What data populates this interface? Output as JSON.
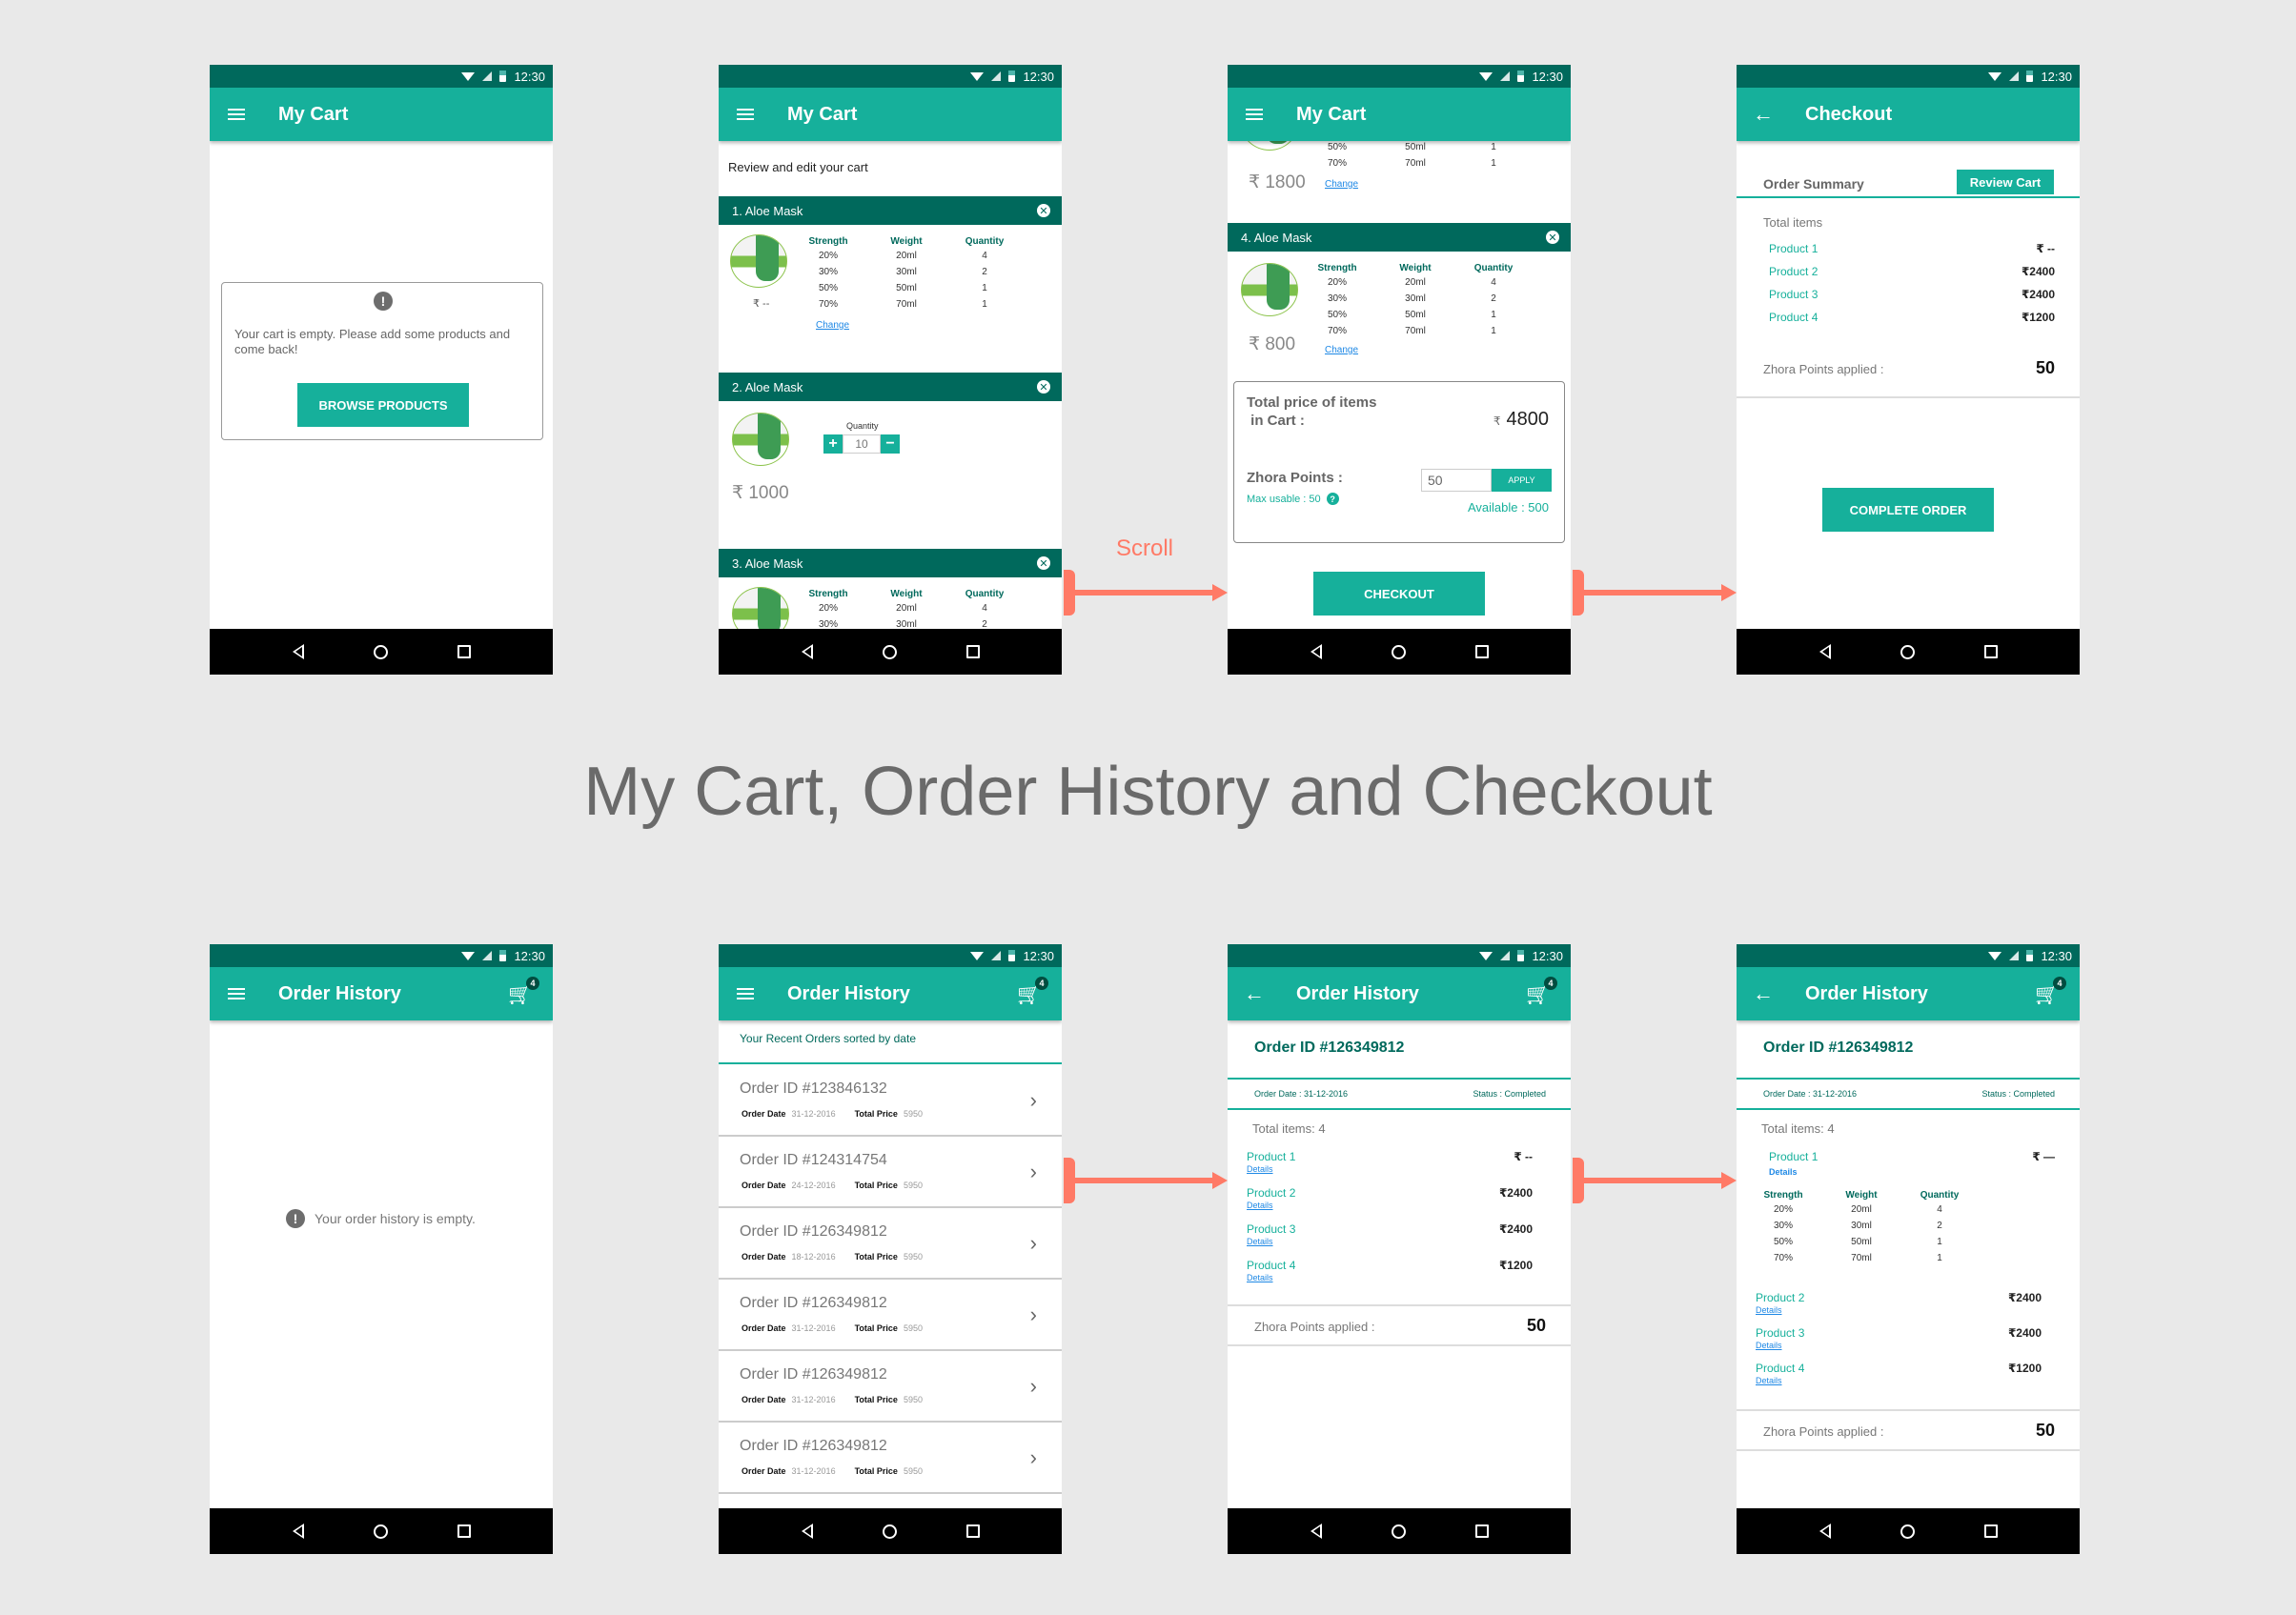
{
  "page_title": "My Cart, Order History and Checkout",
  "status_bar": {
    "time": "12:30"
  },
  "colors": {
    "primary": "#16b09b",
    "primary_dark": "#00695c",
    "accent_arrow": "#ff7a66",
    "link": "#1e88e5",
    "background": "#e9e9e9"
  },
  "flow_arrows": {
    "scroll_label": "Scroll"
  },
  "screens": {
    "cart_empty": {
      "title": "My Cart",
      "nav_icon": "hamburger-menu-icon",
      "message": "Your cart is empty. Please add some products and come back!",
      "browse_button": "BROWSE PRODUCTS"
    },
    "cart_review": {
      "title": "My Cart",
      "subtitle": "Review and edit your cart",
      "columns": [
        "Strength",
        "Weight",
        "Quantity"
      ],
      "items": [
        {
          "name": "1. Aloe Mask",
          "price": "₹ --",
          "change": "Change",
          "variants": [
            [
              "20%",
              "20ml",
              "4"
            ],
            [
              "30%",
              "30ml",
              "2"
            ],
            [
              "50%",
              "50ml",
              "1"
            ],
            [
              "70%",
              "70ml",
              "1"
            ]
          ]
        },
        {
          "name": "2. Aloe Mask",
          "price": "₹ 1000",
          "quantity_label": "Quantity",
          "quantity": "10",
          "plus": "+",
          "minus": "−"
        },
        {
          "name": "3. Aloe Mask",
          "variants": [
            [
              "20%",
              "20ml",
              "4"
            ],
            [
              "30%",
              "30ml",
              "2"
            ]
          ]
        }
      ]
    },
    "cart_scrolled": {
      "title": "My Cart",
      "prev_item": {
        "price": "₹ 1800",
        "change": "Change",
        "variants": [
          [
            "50%",
            "50ml",
            "1"
          ],
          [
            "70%",
            "70ml",
            "1"
          ]
        ]
      },
      "item4": {
        "name": "4. Aloe Mask",
        "price": "₹ 800",
        "change": "Change",
        "variants": [
          [
            "20%",
            "20ml",
            "4"
          ],
          [
            "30%",
            "30ml",
            "2"
          ],
          [
            "50%",
            "50ml",
            "1"
          ],
          [
            "70%",
            "70ml",
            "1"
          ]
        ]
      },
      "total_label": "Total price of items\n in Cart :",
      "total_currency": "₹",
      "total_value": "4800",
      "points_label": "Zhora Points :",
      "points_input": "50",
      "apply_button": "APPLY",
      "max_usable": "Max usable : 50",
      "available": "Available : 500",
      "checkout_button": "CHECKOUT"
    },
    "checkout": {
      "title": "Checkout",
      "order_summary": "Order Summary",
      "review_cart_button": "Review Cart",
      "total_items_label": "Total items",
      "products": [
        {
          "name": "Product 1",
          "price": "₹  --"
        },
        {
          "name": "Product 2",
          "price": "₹2400"
        },
        {
          "name": "Product 3",
          "price": "₹2400"
        },
        {
          "name": "Product 4",
          "price": "₹1200"
        }
      ],
      "points_applied_label": "Zhora Points applied :",
      "points_applied_value": "50",
      "complete_button": "COMPLETE ORDER"
    },
    "history_empty": {
      "title": "Order History",
      "cart_badge": "4",
      "message": "Your order history is empty."
    },
    "history_list": {
      "title": "Order History",
      "cart_badge": "4",
      "subtitle": "Your Recent Orders sorted by date",
      "date_label": "Order Date",
      "price_label": "Total Price",
      "orders": [
        {
          "id": "Order ID #123846132",
          "date": "31-12-2016",
          "price": "5950"
        },
        {
          "id": "Order ID #124314754",
          "date": "24-12-2016",
          "price": "5950"
        },
        {
          "id": "Order ID #126349812",
          "date": "18-12-2016",
          "price": "5950"
        },
        {
          "id": "Order ID #126349812",
          "date": "31-12-2016",
          "price": "5950"
        },
        {
          "id": "Order ID #126349812",
          "date": "31-12-2016",
          "price": "5950"
        },
        {
          "id": "Order ID #126349812",
          "date": "31-12-2016",
          "price": "5950"
        }
      ]
    },
    "order_detail": {
      "title": "Order History",
      "cart_badge": "4",
      "order_id": "Order ID #126349812",
      "order_date": "Order Date : 31-12-2016",
      "status": "Status : Completed",
      "total_items": "Total items: 4",
      "details_label": "Details",
      "products": [
        {
          "name": "Product 1",
          "price": "₹  --"
        },
        {
          "name": "Product 2",
          "price": "₹2400"
        },
        {
          "name": "Product 3",
          "price": "₹2400"
        },
        {
          "name": "Product 4",
          "price": "₹1200"
        }
      ],
      "points_applied_label": "Zhora Points applied :",
      "points_applied_value": "50"
    },
    "order_detail_expanded": {
      "title": "Order History",
      "cart_badge": "4",
      "order_id": "Order ID #126349812",
      "order_date": "Order Date : 31-12-2016",
      "status": "Status : Completed",
      "total_items": "Total items: 4",
      "details_label": "Details",
      "columns": [
        "Strength",
        "Weight",
        "Quantity"
      ],
      "variants": [
        [
          "20%",
          "20ml",
          "4"
        ],
        [
          "30%",
          "30ml",
          "2"
        ],
        [
          "50%",
          "50ml",
          "1"
        ],
        [
          "70%",
          "70ml",
          "1"
        ]
      ],
      "products": [
        {
          "name": "Product 1",
          "price": "₹  —"
        },
        {
          "name": "Product 2",
          "price": "₹2400"
        },
        {
          "name": "Product 3",
          "price": "₹2400"
        },
        {
          "name": "Product 4",
          "price": "₹1200"
        }
      ],
      "points_applied_label": "Zhora Points applied :",
      "points_applied_value": "50"
    }
  }
}
